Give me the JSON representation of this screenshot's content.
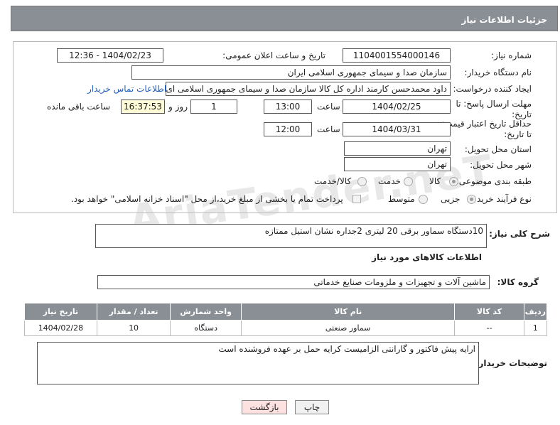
{
  "header": {
    "title": "جزئیات اطلاعات نیاز"
  },
  "form": {
    "need_number_label": "شماره نیاز:",
    "need_number": "1104001554000146",
    "announce_label": "تاریخ و ساعت اعلان عمومی:",
    "announce_value": "1404/02/23 - 12:36",
    "buyer_label": "نام دستگاه خریدار:",
    "buyer_value": "سازمان صدا و سیمای جمهوری اسلامی ایران",
    "creator_label": "ایجاد کننده درخواست:",
    "creator_value": "داود محمدحسن کارمند اداره کل کالا سازمان صدا و سیمای جمهوری اسلامی ای",
    "contact_link": "اطلاعات تماس خریدار",
    "deadline_label": "مهلت ارسال پاسخ: تا تاریخ:",
    "deadline_date": "1404/02/25",
    "time_label": "ساعت",
    "deadline_time": "13:00",
    "days_value": "1",
    "days_label": "روز و",
    "remaining_time": "16:37:53",
    "remaining_label": "ساعت باقی مانده",
    "validity_label": "حداقل تاریخ اعتبار قیمت: تا تاریخ:",
    "validity_date": "1404/03/31",
    "validity_time_label": "ساعت",
    "validity_time": "12:00",
    "province_label": "استان محل تحویل:",
    "province_value": "تهران",
    "city_label": "شهر محل تحویل:",
    "city_value": "تهران",
    "category_label": "طبقه بندی موضوعی:",
    "category_options": [
      "کالا",
      "خدمت",
      "کالا/خدمت"
    ],
    "category_selected": "کالا",
    "process_label": "نوع فرآیند خرید :",
    "process_options": [
      "جزیی",
      "متوسط"
    ],
    "process_selected": "جزیی",
    "payment_note": "پرداخت تمام یا بخشی از مبلغ خرید،از محل \"اسناد خزانه اسلامی\" خواهد بود."
  },
  "description": {
    "label": "شرح کلی نیاز:",
    "value": "10دستگاه سماور برقی 20 لیتری 2جداره نشان استیل ممتازه"
  },
  "goods": {
    "section_title": "اطلاعات کالاهای مورد نیاز",
    "group_label": "گروه کالا:",
    "group_value": "ماشین آلات و تجهیزات و ملزومات صنایع خدماتی",
    "columns": [
      "ردیف",
      "کد کالا",
      "نام کالا",
      "واحد شمارش",
      "تعداد / مقدار",
      "تاریخ نیاز"
    ],
    "rows": [
      {
        "row": "1",
        "code": "--",
        "name": "سماور صنعتی",
        "unit": "دستگاه",
        "qty": "10",
        "date": "1404/02/28"
      }
    ]
  },
  "buyer_notes": {
    "label": "توضیحات خریدار:",
    "value": "ارایه پیش فاکتور و گارانتی الزامیست کرایه حمل بر عهده فروشنده است"
  },
  "buttons": {
    "print": "چاپ",
    "back": "بازگشت"
  },
  "watermark": "AriaTender.neT"
}
